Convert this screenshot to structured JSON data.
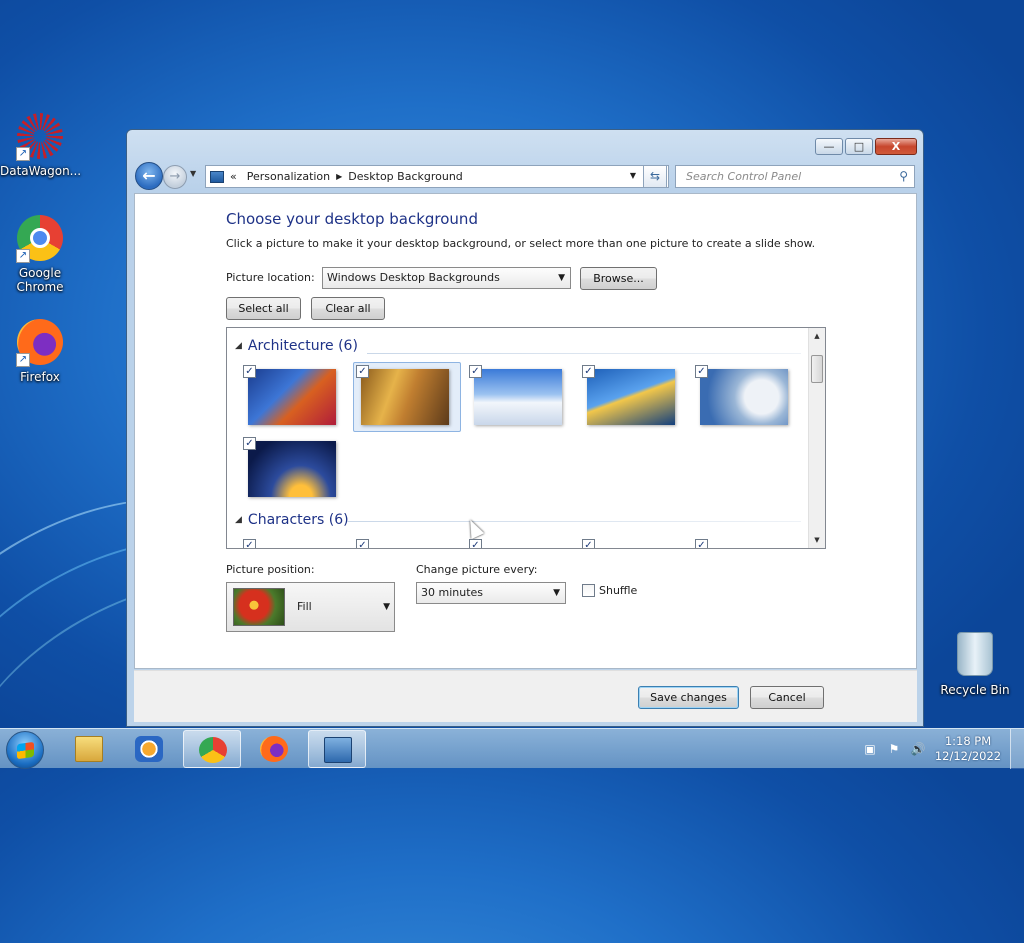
{
  "desktop": {
    "icons": [
      {
        "label": "DataWagon...",
        "icon": "datawagon-icon"
      },
      {
        "label": "Google Chrome",
        "icon": "chrome-icon"
      },
      {
        "label": "Firefox",
        "icon": "firefox-icon"
      },
      {
        "label": "Recycle Bin",
        "icon": "recycle-bin-icon"
      }
    ]
  },
  "window": {
    "caption": {
      "minimize": "—",
      "maximize": "□",
      "close": "X"
    },
    "breadcrumb": {
      "prefix": "«",
      "items": [
        "Personalization",
        "Desktop Background"
      ]
    },
    "search_placeholder": "Search Control Panel",
    "heading": "Choose your desktop background",
    "description": "Click a picture to make it your desktop background, or select more than one picture to create a slide show.",
    "picture_location": {
      "label": "Picture location:",
      "value": "Windows Desktop Backgrounds",
      "browse": "Browse..."
    },
    "select_all": "Select all",
    "clear_all": "Clear all",
    "groups": [
      {
        "name": "Architecture (6)",
        "thumbnails": 6,
        "all_checked": true,
        "selected_index": 1
      },
      {
        "name": "Characters (6)",
        "thumbnails": 6,
        "all_checked": true
      }
    ],
    "picture_position": {
      "label": "Picture position:",
      "value": "Fill"
    },
    "change_picture": {
      "label": "Change picture every:",
      "value": "30 minutes"
    },
    "shuffle": {
      "label": "Shuffle",
      "checked": false
    },
    "save": "Save changes",
    "cancel": "Cancel"
  },
  "taskbar": {
    "pinned": [
      "windows-explorer-icon",
      "media-player-icon",
      "chrome-icon",
      "firefox-icon",
      "control-panel-icon"
    ],
    "active": "chrome-icon",
    "clock": {
      "time": "1:18 PM",
      "date": "12/12/2022"
    }
  },
  "colors": {
    "heading": "#1e3287",
    "desktop": "#1f6fc8",
    "selection": "#e3edf9"
  }
}
